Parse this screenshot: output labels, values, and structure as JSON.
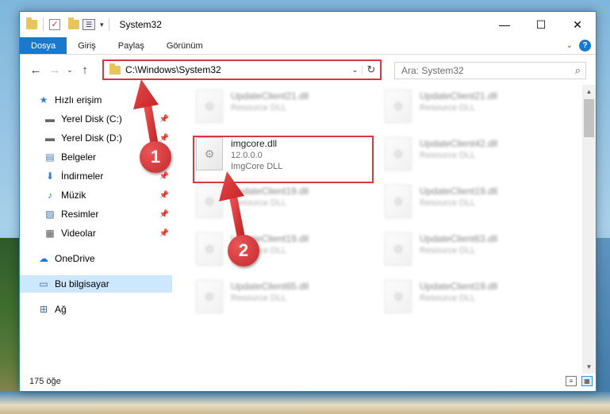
{
  "window": {
    "title": "System32",
    "qa_props_glyph": "☰",
    "qa_dropdown_glyph": "▾",
    "minimize_glyph": "—",
    "maximize_glyph": "☐",
    "close_glyph": "✕"
  },
  "ribbon": {
    "tabs": [
      "Dosya",
      "Giriş",
      "Paylaş",
      "Görünüm"
    ],
    "collapse_glyph": "⌄",
    "help_glyph": "?"
  },
  "nav": {
    "back_glyph": "←",
    "forward_glyph": "→",
    "recent_glyph": "⌄",
    "up_glyph": "↑"
  },
  "address": {
    "path": "C:\\Windows\\System32",
    "dropdown_glyph": "⌄",
    "refresh_glyph": "↻"
  },
  "search": {
    "placeholder": "Ara: System32",
    "icon_glyph": "⌕"
  },
  "sidebar": {
    "pin_glyph": "📌",
    "items": [
      {
        "label": "Hızlı erişim",
        "icon": "star-icon",
        "glyph": "★",
        "color": "#2f7fd1",
        "pinned": false
      },
      {
        "label": "Yerel Disk (C:)",
        "icon": "drive-icon",
        "glyph": "▬",
        "color": "#666666",
        "pinned": true
      },
      {
        "label": "Yerel Disk (D:)",
        "icon": "drive-icon",
        "glyph": "▬",
        "color": "#666666",
        "pinned": true
      },
      {
        "label": "Belgeler",
        "icon": "documents-icon",
        "glyph": "▤",
        "color": "#4a78b5",
        "pinned": true
      },
      {
        "label": "İndirmeler",
        "icon": "download-icon",
        "glyph": "⬇",
        "color": "#2f7fd1",
        "pinned": true
      },
      {
        "label": "Müzik",
        "icon": "music-icon",
        "glyph": "♪",
        "color": "#2f7fd1",
        "pinned": true
      },
      {
        "label": "Resimler",
        "icon": "pictures-icon",
        "glyph": "▨",
        "color": "#3b6aa0",
        "pinned": true
      },
      {
        "label": "Videolar",
        "icon": "videos-icon",
        "glyph": "▦",
        "color": "#555555",
        "pinned": true
      },
      {
        "label": "OneDrive",
        "icon": "cloud-icon",
        "glyph": "☁",
        "color": "#1f78d1",
        "pinned": false
      },
      {
        "label": "Bu bilgisayar",
        "icon": "computer-icon",
        "glyph": "▭",
        "color": "#3b6aa0",
        "pinned": false
      },
      {
        "label": "Ağ",
        "icon": "network-icon",
        "glyph": "⊞",
        "color": "#3b6aa0",
        "pinned": false
      }
    ]
  },
  "files": {
    "icon_glyph": "⚙",
    "items": [
      {
        "name": "UpdateClient21.dll",
        "sub": "Resource DLL",
        "blurred": true
      },
      {
        "name": "UpdateClient21.dll",
        "sub": "Resource DLL",
        "blurred": true
      },
      {
        "name": "imgcore.dll",
        "version": "12.0.0.0",
        "sub": "ImgCore DLL",
        "blurred": false
      },
      {
        "name": "UpdateClient42.dll",
        "sub": "Resource DLL",
        "blurred": true
      },
      {
        "name": "UpdateClient19.dll",
        "sub": "Resource DLL",
        "blurred": true
      },
      {
        "name": "UpdateClient19.dll",
        "sub": "Resource DLL",
        "blurred": true
      },
      {
        "name": "UpdateClient19.dll",
        "sub": "Resource DLL",
        "blurred": true
      },
      {
        "name": "UpdateClient63.dll",
        "sub": "Resource DLL",
        "blurred": true
      },
      {
        "name": "UpdateClient65.dll",
        "sub": "Resource DLL",
        "blurred": true
      },
      {
        "name": "UpdateClient19.dll",
        "sub": "Resource DLL",
        "blurred": true
      }
    ]
  },
  "scrollbar": {
    "up_glyph": "▲",
    "down_glyph": "▼"
  },
  "status": {
    "count": "175 öğe",
    "details_view_glyph": "≡",
    "tiles_view_glyph": "▦"
  },
  "callouts": [
    {
      "number": "1"
    },
    {
      "number": "2"
    }
  ],
  "colors": {
    "accent": "#1979ca",
    "highlight": "#d9373d",
    "selection": "#cce8ff"
  }
}
